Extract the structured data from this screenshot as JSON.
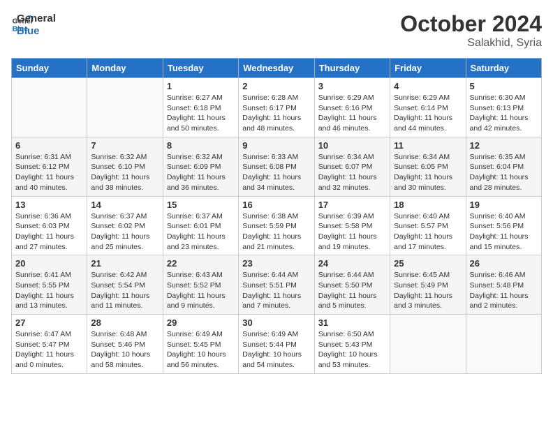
{
  "header": {
    "logo_line1": "General",
    "logo_line2": "Blue",
    "month": "October 2024",
    "location": "Salakhid, Syria"
  },
  "weekdays": [
    "Sunday",
    "Monday",
    "Tuesday",
    "Wednesday",
    "Thursday",
    "Friday",
    "Saturday"
  ],
  "weeks": [
    [
      {
        "day": "",
        "info": ""
      },
      {
        "day": "",
        "info": ""
      },
      {
        "day": "1",
        "info": "Sunrise: 6:27 AM\nSunset: 6:18 PM\nDaylight: 11 hours and 50 minutes."
      },
      {
        "day": "2",
        "info": "Sunrise: 6:28 AM\nSunset: 6:17 PM\nDaylight: 11 hours and 48 minutes."
      },
      {
        "day": "3",
        "info": "Sunrise: 6:29 AM\nSunset: 6:16 PM\nDaylight: 11 hours and 46 minutes."
      },
      {
        "day": "4",
        "info": "Sunrise: 6:29 AM\nSunset: 6:14 PM\nDaylight: 11 hours and 44 minutes."
      },
      {
        "day": "5",
        "info": "Sunrise: 6:30 AM\nSunset: 6:13 PM\nDaylight: 11 hours and 42 minutes."
      }
    ],
    [
      {
        "day": "6",
        "info": "Sunrise: 6:31 AM\nSunset: 6:12 PM\nDaylight: 11 hours and 40 minutes."
      },
      {
        "day": "7",
        "info": "Sunrise: 6:32 AM\nSunset: 6:10 PM\nDaylight: 11 hours and 38 minutes."
      },
      {
        "day": "8",
        "info": "Sunrise: 6:32 AM\nSunset: 6:09 PM\nDaylight: 11 hours and 36 minutes."
      },
      {
        "day": "9",
        "info": "Sunrise: 6:33 AM\nSunset: 6:08 PM\nDaylight: 11 hours and 34 minutes."
      },
      {
        "day": "10",
        "info": "Sunrise: 6:34 AM\nSunset: 6:07 PM\nDaylight: 11 hours and 32 minutes."
      },
      {
        "day": "11",
        "info": "Sunrise: 6:34 AM\nSunset: 6:05 PM\nDaylight: 11 hours and 30 minutes."
      },
      {
        "day": "12",
        "info": "Sunrise: 6:35 AM\nSunset: 6:04 PM\nDaylight: 11 hours and 28 minutes."
      }
    ],
    [
      {
        "day": "13",
        "info": "Sunrise: 6:36 AM\nSunset: 6:03 PM\nDaylight: 11 hours and 27 minutes."
      },
      {
        "day": "14",
        "info": "Sunrise: 6:37 AM\nSunset: 6:02 PM\nDaylight: 11 hours and 25 minutes."
      },
      {
        "day": "15",
        "info": "Sunrise: 6:37 AM\nSunset: 6:01 PM\nDaylight: 11 hours and 23 minutes."
      },
      {
        "day": "16",
        "info": "Sunrise: 6:38 AM\nSunset: 5:59 PM\nDaylight: 11 hours and 21 minutes."
      },
      {
        "day": "17",
        "info": "Sunrise: 6:39 AM\nSunset: 5:58 PM\nDaylight: 11 hours and 19 minutes."
      },
      {
        "day": "18",
        "info": "Sunrise: 6:40 AM\nSunset: 5:57 PM\nDaylight: 11 hours and 17 minutes."
      },
      {
        "day": "19",
        "info": "Sunrise: 6:40 AM\nSunset: 5:56 PM\nDaylight: 11 hours and 15 minutes."
      }
    ],
    [
      {
        "day": "20",
        "info": "Sunrise: 6:41 AM\nSunset: 5:55 PM\nDaylight: 11 hours and 13 minutes."
      },
      {
        "day": "21",
        "info": "Sunrise: 6:42 AM\nSunset: 5:54 PM\nDaylight: 11 hours and 11 minutes."
      },
      {
        "day": "22",
        "info": "Sunrise: 6:43 AM\nSunset: 5:52 PM\nDaylight: 11 hours and 9 minutes."
      },
      {
        "day": "23",
        "info": "Sunrise: 6:44 AM\nSunset: 5:51 PM\nDaylight: 11 hours and 7 minutes."
      },
      {
        "day": "24",
        "info": "Sunrise: 6:44 AM\nSunset: 5:50 PM\nDaylight: 11 hours and 5 minutes."
      },
      {
        "day": "25",
        "info": "Sunrise: 6:45 AM\nSunset: 5:49 PM\nDaylight: 11 hours and 3 minutes."
      },
      {
        "day": "26",
        "info": "Sunrise: 6:46 AM\nSunset: 5:48 PM\nDaylight: 11 hours and 2 minutes."
      }
    ],
    [
      {
        "day": "27",
        "info": "Sunrise: 6:47 AM\nSunset: 5:47 PM\nDaylight: 11 hours and 0 minutes."
      },
      {
        "day": "28",
        "info": "Sunrise: 6:48 AM\nSunset: 5:46 PM\nDaylight: 10 hours and 58 minutes."
      },
      {
        "day": "29",
        "info": "Sunrise: 6:49 AM\nSunset: 5:45 PM\nDaylight: 10 hours and 56 minutes."
      },
      {
        "day": "30",
        "info": "Sunrise: 6:49 AM\nSunset: 5:44 PM\nDaylight: 10 hours and 54 minutes."
      },
      {
        "day": "31",
        "info": "Sunrise: 6:50 AM\nSunset: 5:43 PM\nDaylight: 10 hours and 53 minutes."
      },
      {
        "day": "",
        "info": ""
      },
      {
        "day": "",
        "info": ""
      }
    ]
  ]
}
